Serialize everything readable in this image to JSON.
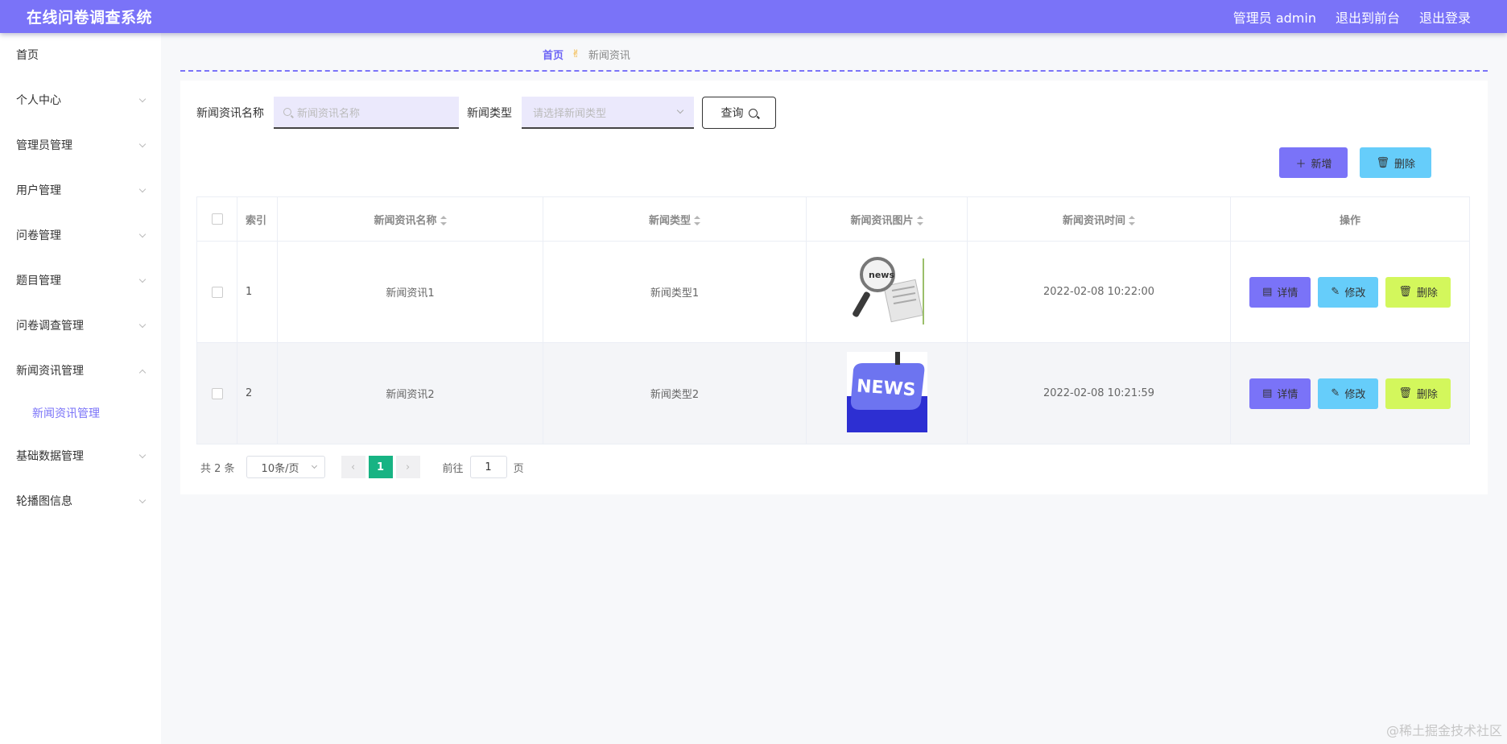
{
  "header": {
    "title": "在线问卷调查系统",
    "admin": "管理员 admin",
    "to_front": "退出到前台",
    "logout": "退出登录"
  },
  "sidebar": {
    "items": [
      {
        "label": "首页"
      },
      {
        "label": "个人中心"
      },
      {
        "label": "管理员管理"
      },
      {
        "label": "用户管理"
      },
      {
        "label": "问卷管理"
      },
      {
        "label": "题目管理"
      },
      {
        "label": "问卷调查管理"
      },
      {
        "label": "新闻资讯管理"
      },
      {
        "label": "基础数据管理"
      },
      {
        "label": "轮播图信息"
      }
    ],
    "sub_active": "新闻资讯管理"
  },
  "breadcrumb": {
    "home": "首页",
    "sep": "✌",
    "current": "新闻资讯"
  },
  "search": {
    "name_label": "新闻资讯名称",
    "name_placeholder": "新闻资讯名称",
    "type_label": "新闻类型",
    "type_placeholder": "请选择新闻类型",
    "query": "查询"
  },
  "actions": {
    "add": "新增",
    "delete": "删除"
  },
  "table": {
    "headers": {
      "index": "索引",
      "name": "新闻资讯名称",
      "type": "新闻类型",
      "image": "新闻资讯图片",
      "time": "新闻资讯时间",
      "ops": "操作"
    },
    "rows": [
      {
        "index": "1",
        "name": "新闻资讯1",
        "type": "新闻类型1",
        "time": "2022-02-08 10:22:00"
      },
      {
        "index": "2",
        "name": "新闻资讯2",
        "type": "新闻类型2",
        "time": "2022-02-08 10:21:59"
      }
    ],
    "op_detail": "详情",
    "op_edit": "修改",
    "op_delete": "删除",
    "images": [
      "news",
      "NEWS"
    ]
  },
  "pager": {
    "total": "共 2 条",
    "size": "10条/页",
    "page": "1",
    "goto": "前往",
    "goto_value": "1",
    "unit": "页"
  },
  "watermark": "@稀土掘金技术社区",
  "colors": {
    "accent": "#7a73f8",
    "blue": "#66cdfa",
    "lime": "#d3f75c",
    "pager_active": "#17b383"
  }
}
